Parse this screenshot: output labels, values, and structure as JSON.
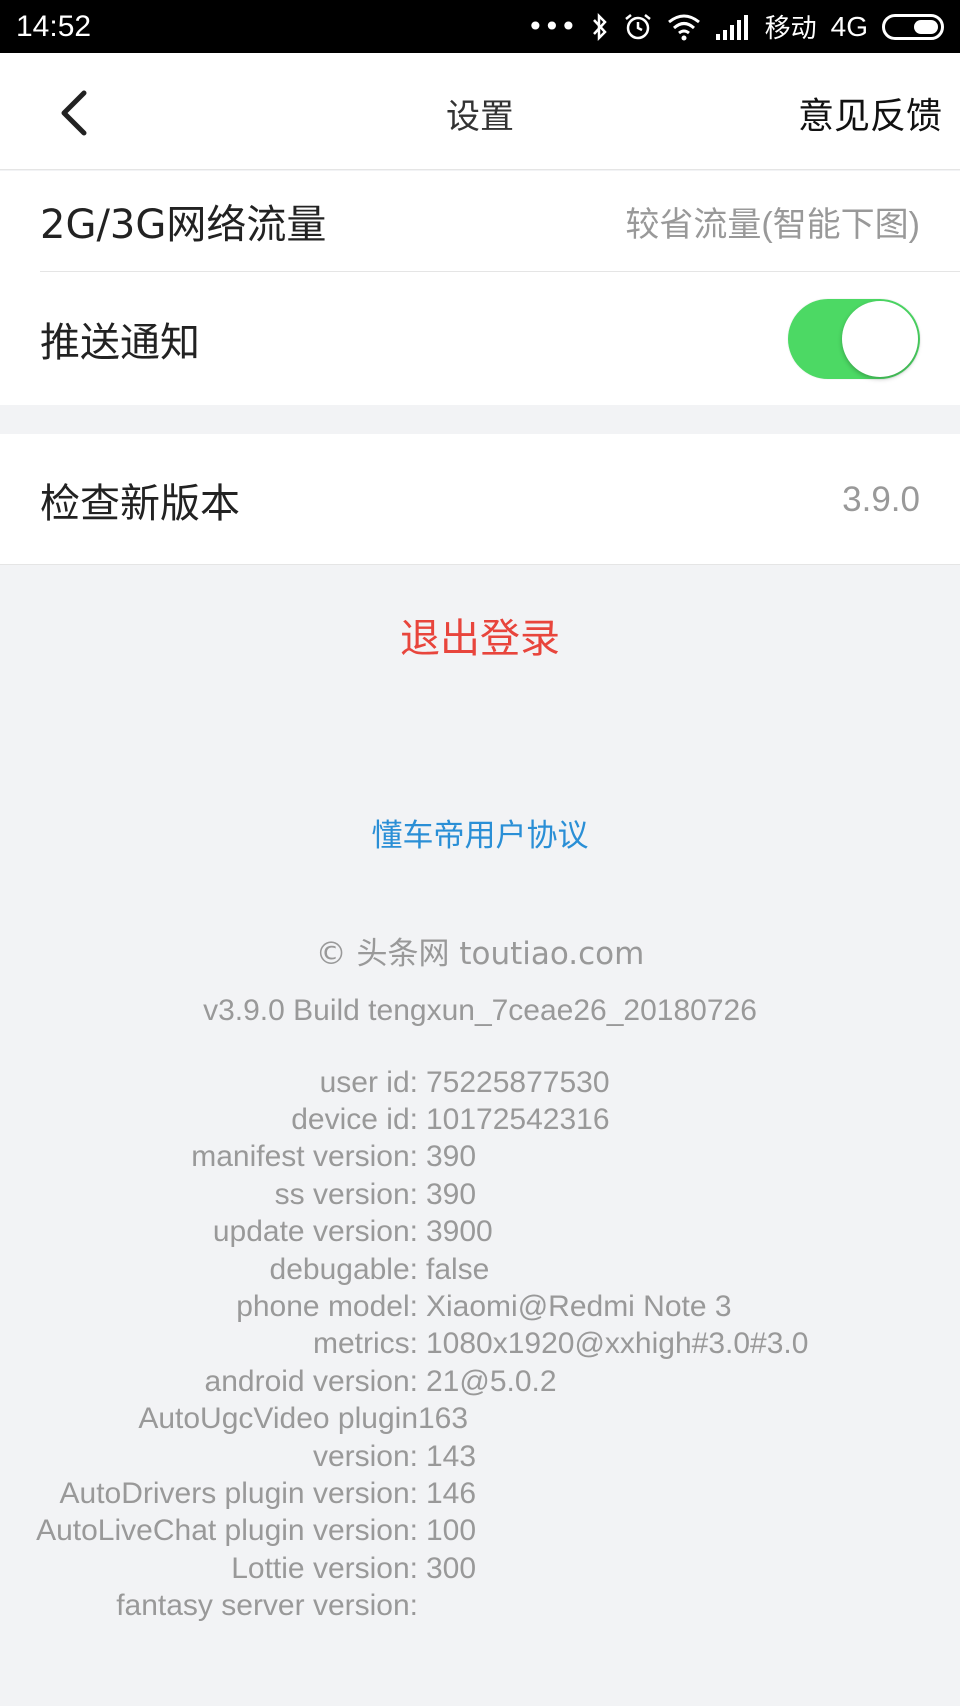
{
  "status_bar": {
    "time": "14:52",
    "dots": "•••",
    "carrier": "移动",
    "network": "4G"
  },
  "nav": {
    "title": "设置",
    "feedback": "意见反馈"
  },
  "settings": {
    "data_usage": {
      "label": "2G/3G网络流量",
      "value": "较省流量(智能下图)"
    },
    "push": {
      "label": "推送通知",
      "enabled": true
    },
    "update": {
      "label": "检查新版本",
      "value": "3.9.0"
    }
  },
  "logout": "退出登录",
  "agreement": "懂车帝用户协议",
  "copyright": "© 头条网 toutiao.com",
  "build": "v3.9.0 Build tengxun_7ceae26_20180726",
  "info": [
    {
      "key": "user id:",
      "value": "75225877530"
    },
    {
      "key": "device id:",
      "value": "10172542316"
    },
    {
      "key": "manifest version:",
      "value": "390"
    },
    {
      "key": "ss version:",
      "value": "390"
    },
    {
      "key": "update version:",
      "value": "3900"
    },
    {
      "key": "debugable:",
      "value": "false"
    },
    {
      "key": "phone model:",
      "value": "Xiaomi@Redmi Note 3"
    },
    {
      "key": "metrics:",
      "value": "1080x1920@xxhigh#3.0#3.0"
    },
    {
      "key": "android version:",
      "value": "21@5.0.2"
    },
    {
      "key": "AutoUgcVideo plugin",
      "value": "163"
    },
    {
      "key": "version:",
      "value": "143"
    },
    {
      "key": "AutoDrivers plugin version:",
      "value": "146"
    },
    {
      "key": "AutoLiveChat plugin version:",
      "value": "100"
    },
    {
      "key": "Lottie version:",
      "value": "300"
    },
    {
      "key": "fantasy server version:",
      "value": ""
    }
  ],
  "colors": {
    "toggle_on": "#4cd964",
    "logout": "#e8453c",
    "link": "#2a8fd6"
  }
}
